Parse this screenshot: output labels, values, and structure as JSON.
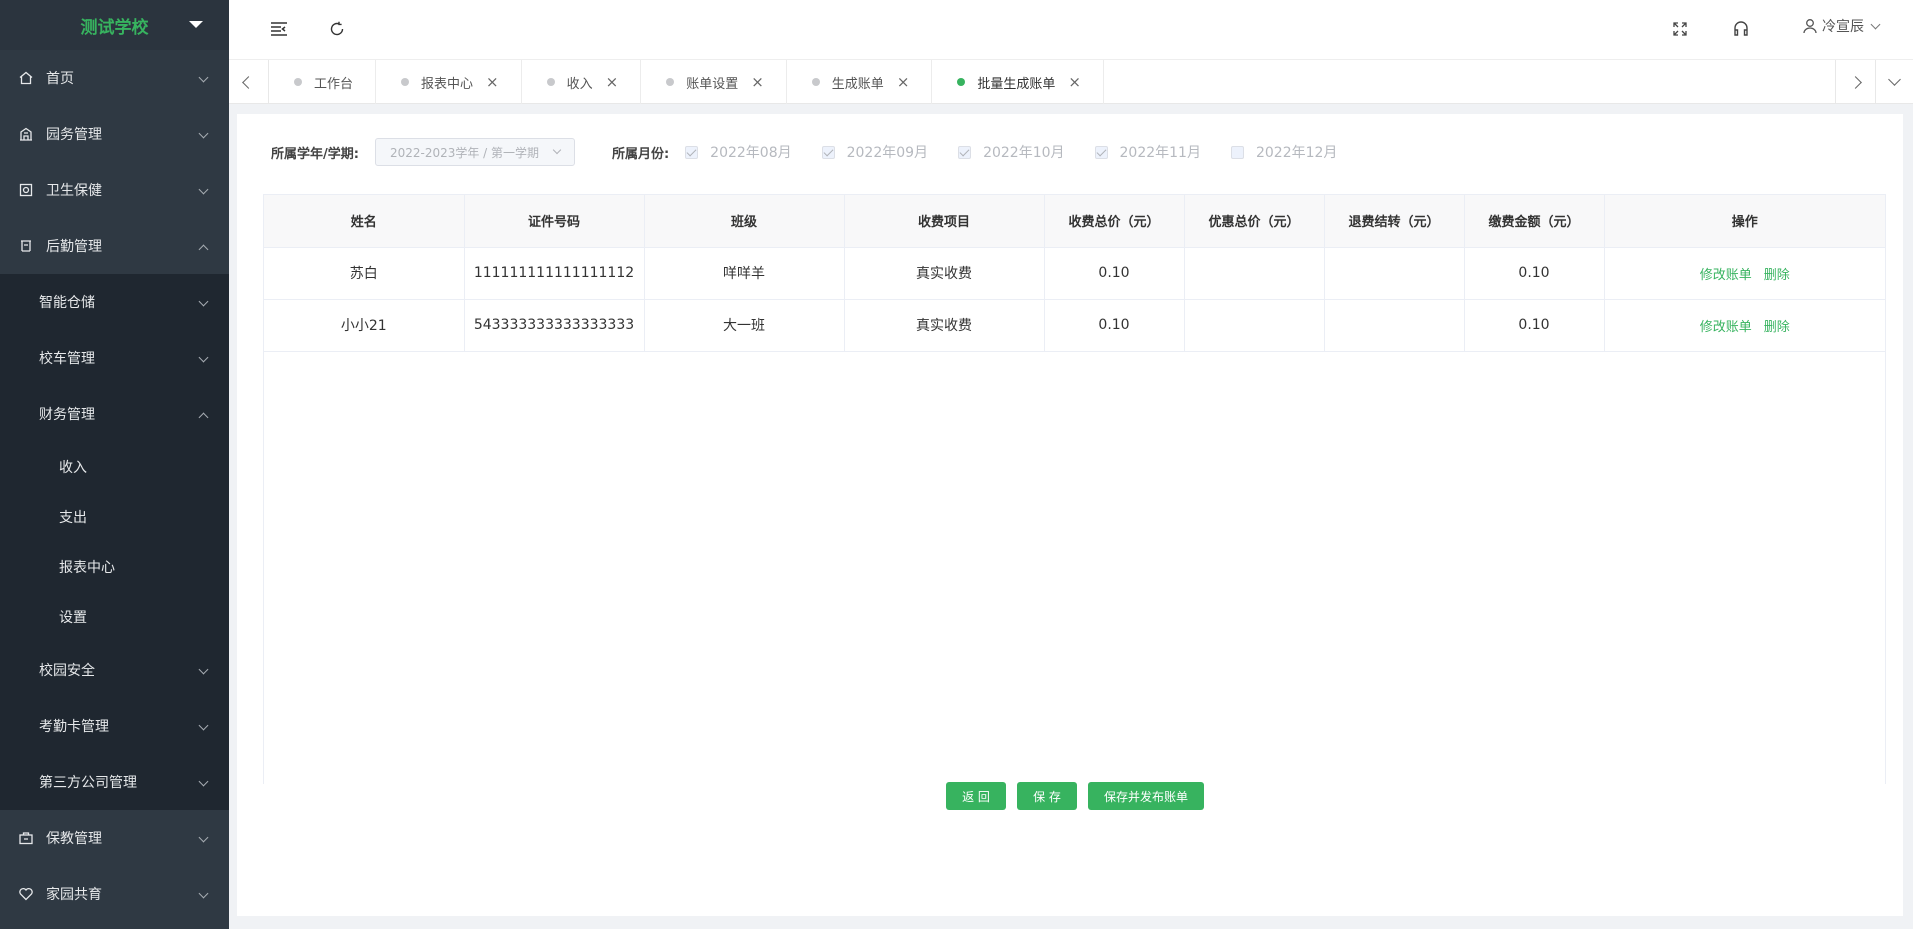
{
  "sidebar": {
    "school_name": "测试学校",
    "items": [
      {
        "label": "首页",
        "icon": "home-icon"
      },
      {
        "label": "园务管理",
        "icon": "building-icon"
      },
      {
        "label": "卫生保健",
        "icon": "health-icon"
      },
      {
        "label": "后勤管理",
        "icon": "logistics-icon"
      }
    ],
    "logistics_sub": [
      {
        "label": "智能仓储"
      },
      {
        "label": "校车管理"
      },
      {
        "label": "财务管理"
      }
    ],
    "finance_sub": [
      {
        "label": "收入"
      },
      {
        "label": "支出"
      },
      {
        "label": "报表中心"
      },
      {
        "label": "设置"
      }
    ],
    "logistics_sub2": [
      {
        "label": "校园安全"
      },
      {
        "label": "考勤卡管理"
      },
      {
        "label": "第三方公司管理"
      }
    ],
    "bottom_items": [
      {
        "label": "保教管理",
        "icon": "briefcase-icon"
      },
      {
        "label": "家园共育",
        "icon": "heart-icon"
      }
    ]
  },
  "header": {
    "user_name": "冷宣辰"
  },
  "tabs": [
    {
      "label": "工作台",
      "closable": false,
      "active": false
    },
    {
      "label": "报表中心",
      "closable": true,
      "active": false
    },
    {
      "label": "收入",
      "closable": true,
      "active": false
    },
    {
      "label": "账单设置",
      "closable": true,
      "active": false
    },
    {
      "label": "生成账单",
      "closable": true,
      "active": false
    },
    {
      "label": "批量生成账单",
      "closable": true,
      "active": true
    }
  ],
  "filters": {
    "term_label": "所属学年/学期:",
    "term_value": "2022-2023学年 / 第一学期",
    "month_label": "所属月份:",
    "months": [
      {
        "label": "2022年08月",
        "checked": true
      },
      {
        "label": "2022年09月",
        "checked": true
      },
      {
        "label": "2022年10月",
        "checked": true
      },
      {
        "label": "2022年11月",
        "checked": true
      },
      {
        "label": "2022年12月",
        "checked": false
      }
    ]
  },
  "table": {
    "headers": [
      "姓名",
      "证件号码",
      "班级",
      "收费项目",
      "收费总价（元）",
      "优惠总价（元）",
      "退费结转（元）",
      "缴费金额（元）",
      "操作"
    ],
    "rows": [
      {
        "name": "苏白",
        "id_no": "111111111111111112",
        "class": "咩咩羊",
        "item": "真实收费",
        "total": "0.10",
        "discount": "",
        "refund": "",
        "paid": "0.10",
        "op_edit": "修改账单",
        "op_delete": "删除"
      },
      {
        "name": "小小21",
        "id_no": "543333333333333333",
        "class": "大一班",
        "item": "真实收费",
        "total": "0.10",
        "discount": "",
        "refund": "",
        "paid": "0.10",
        "op_edit": "修改账单",
        "op_delete": "删除"
      }
    ]
  },
  "actions": {
    "back": "返 回",
    "save": "保 存",
    "save_publish": "保存并发布账单"
  },
  "colors": {
    "accent": "#37b35f",
    "sidebar_bg": "#2f3943",
    "submenu_bg": "#1f2730"
  }
}
